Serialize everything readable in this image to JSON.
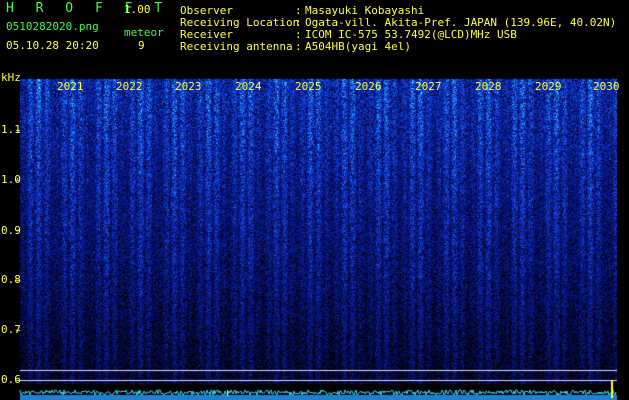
{
  "app": {
    "title": "H R O F F T",
    "version": "1.00",
    "filename": "0510282020.png",
    "datetime": "05.10.28 20:20",
    "mode_label": "meteor",
    "meteor_count": "9"
  },
  "info": [
    {
      "key": "Observer",
      "sep": ":",
      "value": "Masayuki Kobayashi"
    },
    {
      "key": "Receiving Location",
      "sep": ":",
      "value": "Ogata-vill. Akita-Pref. JAPAN (139.96E, 40.02N)"
    },
    {
      "key": "Receiver",
      "sep": ":",
      "value": "ICOM IC-575 53.7492(@LCD)MHz USB"
    },
    {
      "key": "Receiving antenna",
      "sep": ":",
      "value": "A504HB(yagi 4el)"
    }
  ],
  "spectrogram": {
    "y_unit": "kHz",
    "y_ticks": [
      "1.1",
      "1.0",
      "0.9",
      "0.8",
      "0.7",
      "0.6"
    ],
    "x_ticks": [
      "2021",
      "2022",
      "2023",
      "2024",
      "2025",
      "2026",
      "2027",
      "2028",
      "2029",
      "2030"
    ],
    "colors": {
      "background": "#000000",
      "low": "#0a1aa0",
      "mid": "#2a6cff",
      "high": "#40ffe0",
      "peak": "#ffff40"
    }
  }
}
